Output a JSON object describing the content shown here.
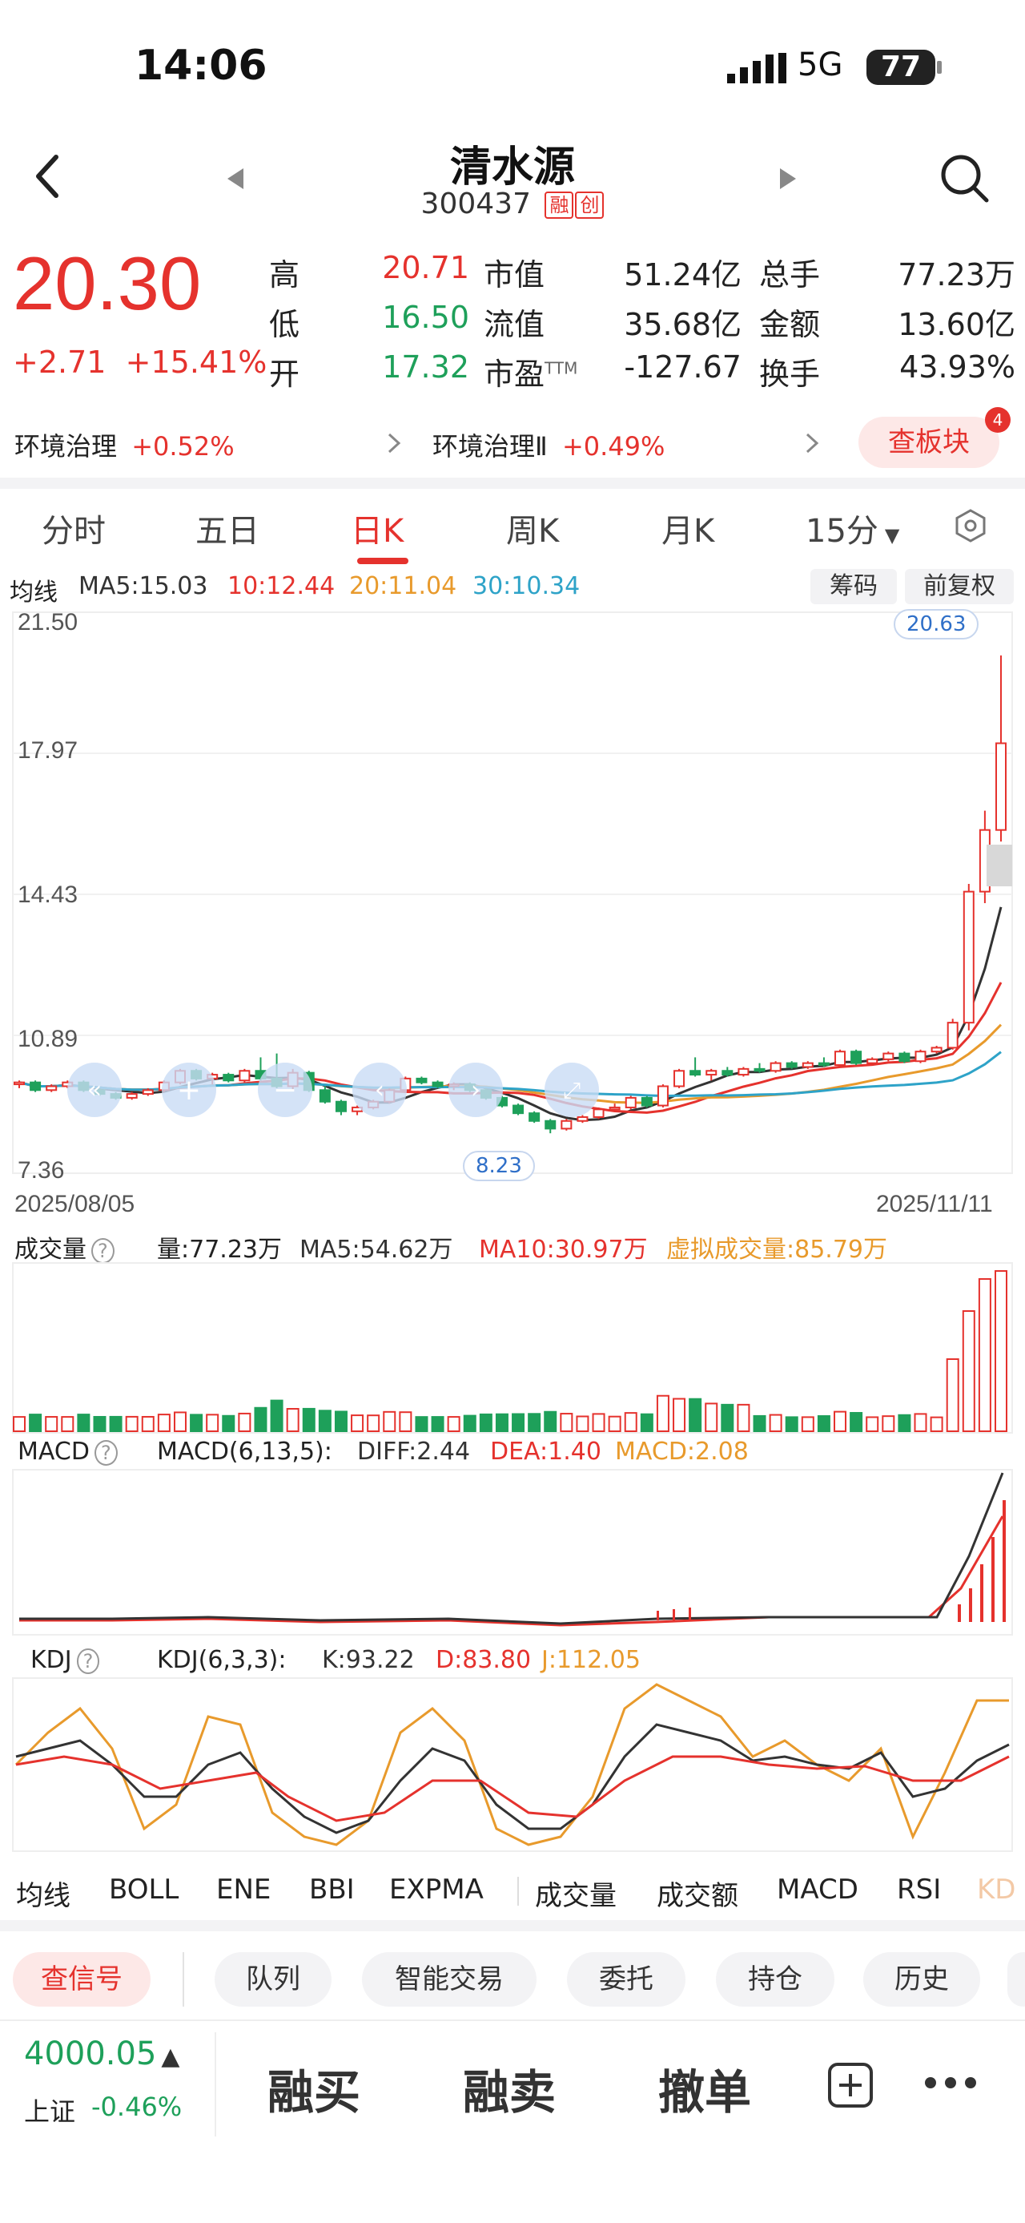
{
  "status": {
    "time": "14:06",
    "network": "5G",
    "battery": "77"
  },
  "header": {
    "title": "清水源",
    "code": "300437",
    "tags": [
      "融",
      "创"
    ]
  },
  "quote": {
    "price": "20.30",
    "change": "+2.71",
    "change_pct": "+15.41%",
    "col1": [
      {
        "label": "高",
        "value": "20.71",
        "color": "red"
      },
      {
        "label": "低",
        "value": "16.50",
        "color": "green"
      },
      {
        "label": "开",
        "value": "17.32",
        "color": "green"
      }
    ],
    "col2": [
      {
        "label": "市值",
        "value": "51.24亿"
      },
      {
        "label": "流值",
        "value": "35.68亿"
      },
      {
        "label": "市盈",
        "sup": "TTM",
        "value": "-127.67"
      }
    ],
    "col3": [
      {
        "label": "总手",
        "value": "77.23万"
      },
      {
        "label": "金额",
        "value": "13.60亿"
      },
      {
        "label": "换手",
        "value": "43.93%"
      }
    ]
  },
  "sectors": [
    {
      "name": "环境治理",
      "change": "+0.52%"
    },
    {
      "name": "环境治理Ⅱ",
      "change": "+0.49%"
    }
  ],
  "board_button": {
    "label": "查板块",
    "badge": "4"
  },
  "tabs": [
    "分时",
    "五日",
    "日K",
    "周K",
    "月K",
    "15分"
  ],
  "active_tab": "日K",
  "ma_legend": {
    "label": "均线",
    "ma5": "MA5:15.03",
    "ma10": "10:12.44",
    "ma20": "20:11.04",
    "ma30": "30:10.34",
    "btn1": "筹码",
    "btn2": "前复权"
  },
  "colors": {
    "up": "#e5322d",
    "down": "#1ea05a",
    "ma5": "#333333",
    "ma10": "#e5322d",
    "ma20": "#e89a2c",
    "ma30": "#2ea3c8"
  },
  "chart_data": {
    "type": "candlestick",
    "y_ticks": [
      "21.50",
      "17.97",
      "14.43",
      "10.89",
      "7.36"
    ],
    "ylim": [
      7.36,
      21.5
    ],
    "x_start": "2025/08/05",
    "x_end": "2025/11/11",
    "max_label": "20.63",
    "min_label": "8.23",
    "candles": [
      [
        9.5,
        9.6,
        9.4,
        9.55
      ],
      [
        9.55,
        9.6,
        9.3,
        9.35
      ],
      [
        9.35,
        9.5,
        9.3,
        9.45
      ],
      [
        9.45,
        9.6,
        9.4,
        9.55
      ],
      [
        9.55,
        9.6,
        9.3,
        9.35
      ],
      [
        9.35,
        9.4,
        9.2,
        9.25
      ],
      [
        9.25,
        9.3,
        9.1,
        9.15
      ],
      [
        9.15,
        9.3,
        9.1,
        9.25
      ],
      [
        9.25,
        9.4,
        9.2,
        9.35
      ],
      [
        9.35,
        9.6,
        9.3,
        9.55
      ],
      [
        9.55,
        9.9,
        9.5,
        9.85
      ],
      [
        9.85,
        9.9,
        9.6,
        9.65
      ],
      [
        9.65,
        9.8,
        9.5,
        9.75
      ],
      [
        9.75,
        9.8,
        9.55,
        9.6
      ],
      [
        9.6,
        9.9,
        9.55,
        9.85
      ],
      [
        9.85,
        10.2,
        9.6,
        9.65
      ],
      [
        9.65,
        10.3,
        9.4,
        9.45
      ],
      [
        9.45,
        9.9,
        9.35,
        9.8
      ],
      [
        9.8,
        9.85,
        9.3,
        9.35
      ],
      [
        9.35,
        9.45,
        9.0,
        9.05
      ],
      [
        9.05,
        9.1,
        8.7,
        8.8
      ],
      [
        8.8,
        8.95,
        8.7,
        8.9
      ],
      [
        8.9,
        9.1,
        8.85,
        9.05
      ],
      [
        9.05,
        9.4,
        9.0,
        9.35
      ],
      [
        9.35,
        9.7,
        9.3,
        9.65
      ],
      [
        9.65,
        9.7,
        9.5,
        9.55
      ],
      [
        9.55,
        9.6,
        9.4,
        9.45
      ],
      [
        9.45,
        9.55,
        9.35,
        9.5
      ],
      [
        9.5,
        9.55,
        9.3,
        9.35
      ],
      [
        9.35,
        9.4,
        9.1,
        9.15
      ],
      [
        9.15,
        9.2,
        8.9,
        8.95
      ],
      [
        8.95,
        9.0,
        8.7,
        8.75
      ],
      [
        8.75,
        8.8,
        8.5,
        8.55
      ],
      [
        8.55,
        8.6,
        8.23,
        8.35
      ],
      [
        8.35,
        8.6,
        8.3,
        8.55
      ],
      [
        8.55,
        8.7,
        8.5,
        8.65
      ],
      [
        8.65,
        8.9,
        8.6,
        8.85
      ],
      [
        8.85,
        9.0,
        8.8,
        8.9
      ],
      [
        8.9,
        9.2,
        8.85,
        9.15
      ],
      [
        9.15,
        9.2,
        8.9,
        8.95
      ],
      [
        8.95,
        9.5,
        8.9,
        9.45
      ],
      [
        9.45,
        9.9,
        9.4,
        9.85
      ],
      [
        9.85,
        10.2,
        9.7,
        9.75
      ],
      [
        9.75,
        9.9,
        9.6,
        9.85
      ],
      [
        9.85,
        9.95,
        9.7,
        9.75
      ],
      [
        9.75,
        9.95,
        9.7,
        9.9
      ],
      [
        9.9,
        10.05,
        9.8,
        9.85
      ],
      [
        9.85,
        10.1,
        9.8,
        10.05
      ],
      [
        10.05,
        10.1,
        9.9,
        9.95
      ],
      [
        9.95,
        10.1,
        9.9,
        10.05
      ],
      [
        10.05,
        10.2,
        9.95,
        10.0
      ],
      [
        10.0,
        10.4,
        9.95,
        10.35
      ],
      [
        10.35,
        10.4,
        10.0,
        10.05
      ],
      [
        10.05,
        10.2,
        10.0,
        10.15
      ],
      [
        10.15,
        10.35,
        10.1,
        10.3
      ],
      [
        10.3,
        10.35,
        10.05,
        10.1
      ],
      [
        10.1,
        10.4,
        10.05,
        10.35
      ],
      [
        10.35,
        10.5,
        10.3,
        10.45
      ],
      [
        10.45,
        11.2,
        10.4,
        11.1
      ],
      [
        11.1,
        14.7,
        10.9,
        14.5
      ],
      [
        14.5,
        16.6,
        14.2,
        16.1
      ],
      [
        16.1,
        20.63,
        15.8,
        18.35
      ]
    ]
  },
  "volume": {
    "label": "成交量",
    "vol": "量:77.23万",
    "ma5": "MA5:54.62万",
    "ma10": "MA10:30.97万",
    "virtual": "虚拟成交量:85.79万"
  },
  "macd": {
    "label": "MACD",
    "params": "MACD(6,13,5):",
    "diff": "DIFF:2.44",
    "dea": "DEA:1.40",
    "macd": "MACD:2.08"
  },
  "kdj": {
    "label": "KDJ",
    "params": "KDJ(6,3,3):",
    "k": "K:93.22",
    "d": "D:83.80",
    "j": "J:112.05"
  },
  "indicator_tabs": [
    "均线",
    "BOLL",
    "ENE",
    "BBI",
    "EXPMA",
    "成交量",
    "成交额",
    "MACD",
    "RSI",
    "KD"
  ],
  "chips": [
    "查信号",
    "队列",
    "智能交易",
    "委托",
    "持仓",
    "历史"
  ],
  "index": {
    "value": "4000.05",
    "name": "上证",
    "change": "-0.46%"
  },
  "actions": [
    "融买",
    "融卖",
    "撤单"
  ]
}
